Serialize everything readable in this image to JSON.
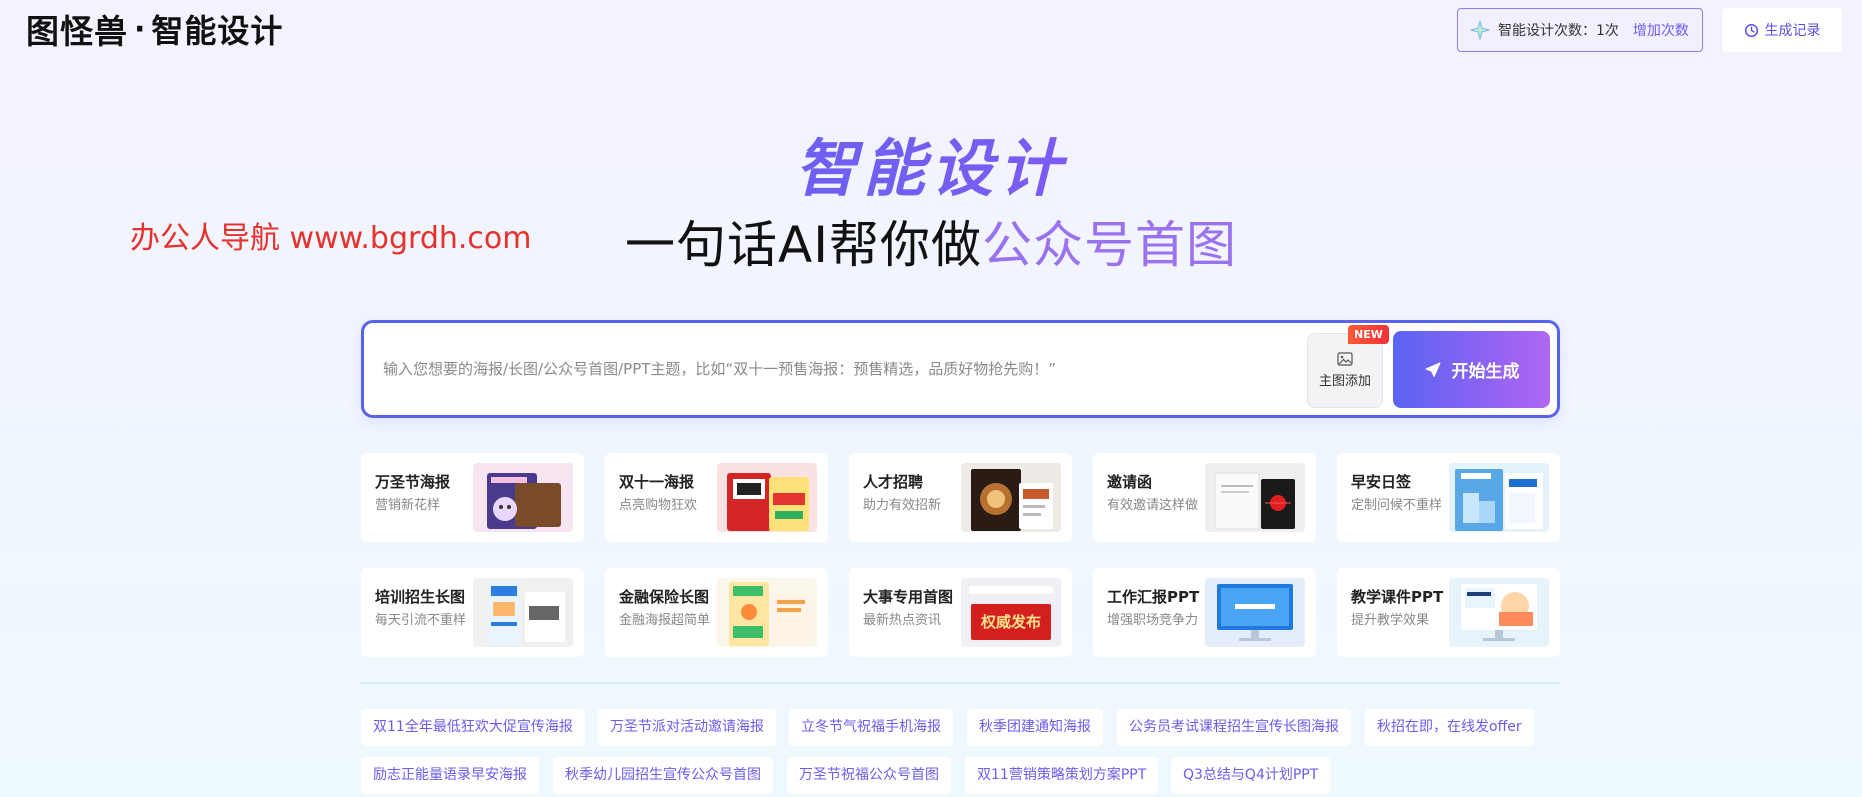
{
  "header": {
    "logo_main": "图怪兽",
    "logo_sep": "·",
    "logo_sub": "智能设计",
    "quota_label": "智能设计次数：1次",
    "quota_more": "增加次数",
    "history_label": "生成记录"
  },
  "hero": {
    "title": "智能设计",
    "subtitle_prefix": "一句话AI帮你做",
    "subtitle_highlight": "公众号首图"
  },
  "watermark": "办公人导航 www.bgrdh.com",
  "search": {
    "placeholder": "输入您想要的海报/长图/公众号首图/PPT主题，比如“双十一预售海报：预售精选，品质好物抢先购！”",
    "upload_label": "主图添加",
    "new_badge": "NEW",
    "generate_label": "开始生成"
  },
  "cards": [
    {
      "title": "万圣节海报",
      "desc": "营销新花样",
      "thumb_color": "#f7e6f2",
      "thumb_icon": "halloween-poster"
    },
    {
      "title": "双十一海报",
      "desc": "点亮购物狂欢",
      "thumb_color": "#fbe2e2",
      "thumb_icon": "double11-poster"
    },
    {
      "title": "人才招聘",
      "desc": "助力有效招新",
      "thumb_color": "#eeeae6",
      "thumb_icon": "recruit-poster"
    },
    {
      "title": "邀请函",
      "desc": "有效邀请这样做",
      "thumb_color": "#efefef",
      "thumb_icon": "invitation"
    },
    {
      "title": "早安日签",
      "desc": "定制问候不重样",
      "thumb_color": "#e4f2fb",
      "thumb_icon": "morning-sign"
    },
    {
      "title": "培训招生长图",
      "desc": "每天引流不重样",
      "thumb_color": "#f0f0f0",
      "thumb_icon": "training-long"
    },
    {
      "title": "金融保险长图",
      "desc": "金融海报超简单",
      "thumb_color": "#fbf6ea",
      "thumb_icon": "finance-long"
    },
    {
      "title": "大事专用首图",
      "desc": "最新热点资讯",
      "thumb_color": "#eef0f5",
      "thumb_icon": "news-cover"
    },
    {
      "title": "工作汇报PPT",
      "desc": "增强职场竞争力",
      "thumb_color": "#e3eefa",
      "thumb_icon": "report-ppt"
    },
    {
      "title": "教学课件PPT",
      "desc": "提升教学效果",
      "thumb_color": "#e6f3fb",
      "thumb_icon": "teaching-ppt"
    }
  ],
  "news_cover_text": "权威发布",
  "tags": [
    "双11全年最低狂欢大促宣传海报",
    "万圣节派对活动邀请海报",
    "立冬节气祝福手机海报",
    "秋季团建通知海报",
    "公务员考试课程招生宣传长图海报",
    "秋招在即，在线发offer",
    "励志正能量语录早安海报",
    "秋季幼儿园招生宣传公众号首图",
    "万圣节祝福公众号首图",
    "双11营销策略策划方案PPT",
    "Q3总结与Q4计划PPT"
  ]
}
